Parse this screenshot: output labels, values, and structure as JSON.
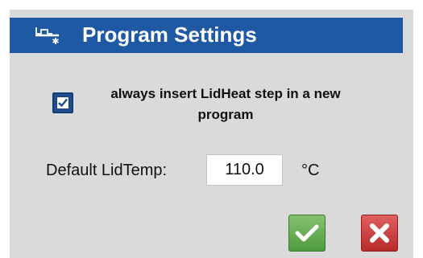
{
  "dialog": {
    "title": "Program Settings",
    "title_icon": "lid-heat-icon"
  },
  "lid_heat_option": {
    "checked": true,
    "label": "always insert LidHeat step in a new program"
  },
  "default_lid_temp": {
    "label": "Default LidTemp:",
    "value": "110.0",
    "unit": "°C"
  },
  "buttons": {
    "ok_icon": "checkmark-icon",
    "cancel_icon": "close-icon"
  },
  "colors": {
    "title_bar": "#1f59a4",
    "dialog_background": "#dadada",
    "ok_button": "#5fa84b",
    "cancel_button": "#cf3b3b"
  }
}
